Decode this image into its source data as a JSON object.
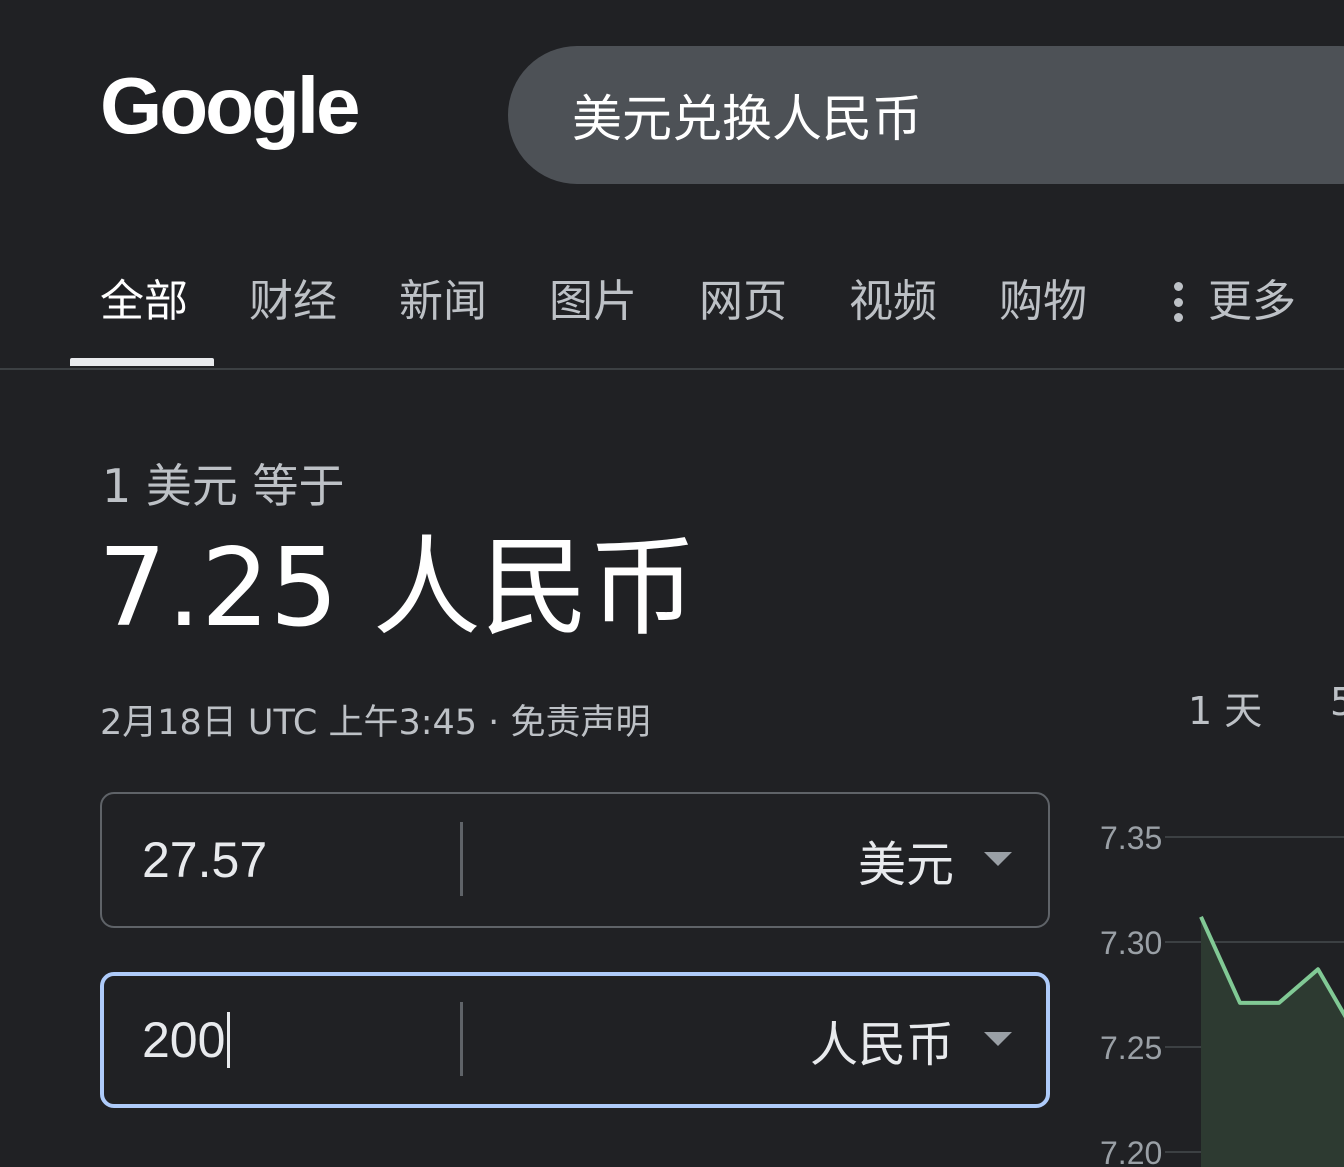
{
  "header": {
    "logo_text": "Google",
    "search_query": "美元兑换人民币"
  },
  "tabs": [
    {
      "label": "全部",
      "active": true
    },
    {
      "label": "财经"
    },
    {
      "label": "新闻"
    },
    {
      "label": "图片"
    },
    {
      "label": "网页"
    },
    {
      "label": "视频"
    },
    {
      "label": "购物"
    },
    {
      "label": "更多"
    }
  ],
  "result": {
    "equals_label": "1 美元 等于",
    "value_text": "7.25 人民币",
    "timestamp": "2月18日 UTC 上午3:45",
    "separator": " · ",
    "disclaimer": "免责声明"
  },
  "converter": {
    "from": {
      "value": "27.57",
      "unit": "美元"
    },
    "to": {
      "value": "200",
      "unit": "人民币"
    }
  },
  "chart": {
    "ranges": [
      "1 天",
      "5"
    ]
  },
  "chart_data": {
    "type": "area",
    "y_ticks": [
      "7.35",
      "7.30",
      "7.25",
      "7.20"
    ],
    "ylim": [
      7.2,
      7.35
    ],
    "values": [
      7.312,
      7.271,
      7.271,
      7.287,
      7.255
    ],
    "line_color": "#81c995",
    "fill_color": "#2d3a31",
    "grid": true
  }
}
